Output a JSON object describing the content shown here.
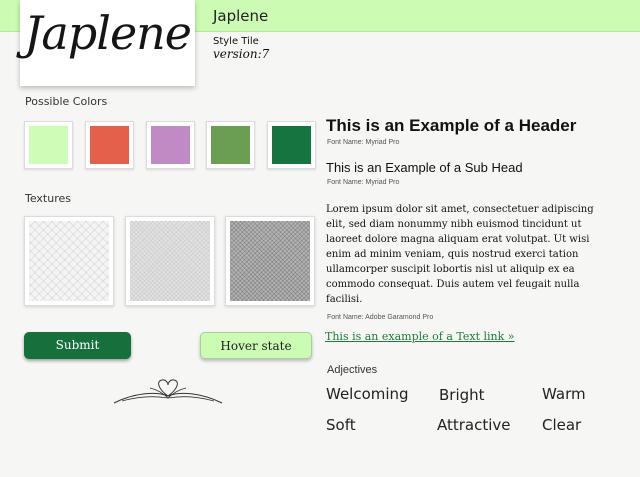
{
  "header": {
    "app_name": "Japlene",
    "logo_text": "Japlene",
    "tile_label": "Style Tile",
    "version": "version:7",
    "bar_color": "#ccfcb4"
  },
  "colors": {
    "title": "Possible Colors",
    "swatches": [
      "#cffcb6",
      "#e4604a",
      "#c08ac4",
      "#6b9e53",
      "#157440"
    ]
  },
  "textures": {
    "title": "Textures"
  },
  "buttons": {
    "submit_label": "Submit",
    "hover_label": "Hover state"
  },
  "typography": {
    "header_example": "This is an Example of a Header",
    "header_font": "Font Name: Myriad Pro",
    "subhead_example": "This is an Example of a Sub Head",
    "subhead_font": "Font Name: Myriad Pro",
    "body_text": "Lorem ipsum dolor sit amet, consectetuer adipiscing elit, sed diam nonummy nibh euismod tincidunt ut laoreet dolore magna aliquam erat volutpat. Ut wisi enim ad minim veniam, quis nostrud exerci tation ullamcorper suscipit lobortis nisl ut aliquip ex ea commodo consequat. Duis autem vel feugait nulla facilisi.",
    "body_font": "Font Name: Adobe Garamond Pro",
    "text_link": "This is an example of a Text link »",
    "link_color": "#1f7a3b"
  },
  "adjectives": {
    "title": "Adjectives",
    "items": [
      "Welcoming",
      "Bright",
      "Warm",
      "Soft",
      "Attractive",
      "Clear"
    ]
  }
}
